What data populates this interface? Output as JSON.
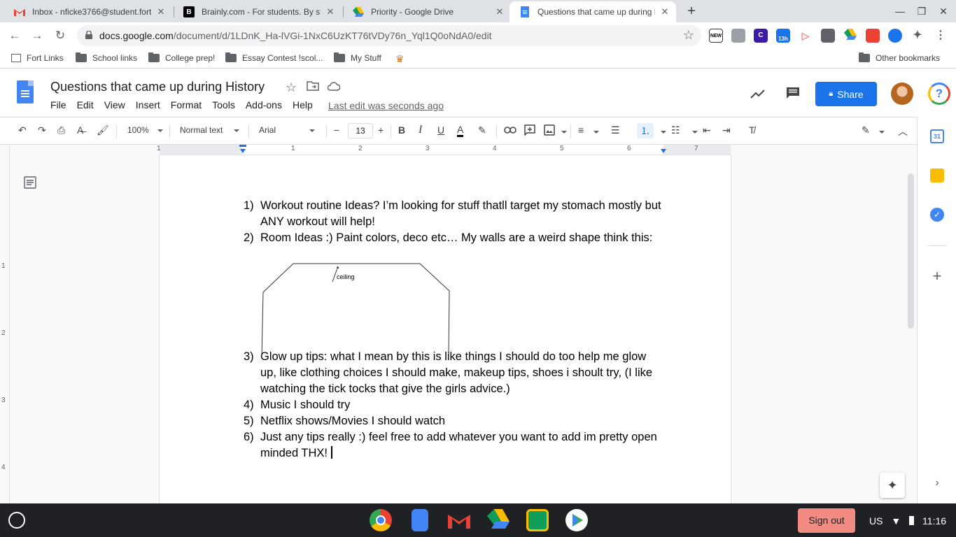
{
  "browser": {
    "tabs": [
      {
        "title": "Inbox - nficke3766@student.fort",
        "icon": "gmail-icon"
      },
      {
        "title": "Brainly.com - For students. By st",
        "icon": "brainly-icon"
      },
      {
        "title": "Priority - Google Drive",
        "icon": "drive-icon"
      },
      {
        "title": "Questions that came up during H",
        "icon": "docs-icon",
        "active": true
      }
    ],
    "url_host": "docs.google.com",
    "url_path": "/document/d/1LDnK_Ha-lVGi-1NxC6UzKT76tVDy76n_Yql1Q0oNdA0/edit",
    "extension_badges": [
      "NEW",
      "13h"
    ],
    "bookmarks": [
      "Fort Links",
      "School links",
      "College prep!",
      "Essay Contest !scol...",
      "My Stuff"
    ],
    "other_bookmarks": "Other bookmarks"
  },
  "doc": {
    "title": "Questions that came up during History",
    "menu": [
      "File",
      "Edit",
      "View",
      "Insert",
      "Format",
      "Tools",
      "Add-ons",
      "Help"
    ],
    "last_edit": "Last edit was seconds ago",
    "share_label": "Share",
    "toolbar": {
      "zoom": "100%",
      "style": "Normal text",
      "font": "Arial",
      "font_size": "13"
    },
    "ruler_numbers": [
      "1",
      "1",
      "2",
      "3",
      "4",
      "5",
      "6",
      "7"
    ],
    "vruler_numbers": [
      "1",
      "2",
      "3",
      "4"
    ],
    "items": [
      {
        "num": "1)",
        "text": "Workout routine Ideas? I’m looking for stuff thatll target my stomach mostly but ANY workout will help!"
      },
      {
        "num": "2)",
        "text": "Room Ideas :) Paint colors, deco etc… My walls are a weird shape think this:"
      },
      {
        "num": "3)",
        "text": "Glow up tips: what I mean by this is like things I should do too help me glow up, like clothing choices I should make, makeup tips, shoes i shoult try, (I like watching the tick tocks that give the girls advice.)"
      },
      {
        "num": "4)",
        "text": "Music I should try"
      },
      {
        "num": "5)",
        "text": "Netflix shows/Movies I should watch"
      },
      {
        "num": "6)",
        "text": "Just any tips really :) feel free to add whatever you want to add im pretty open minded THX! "
      }
    ],
    "drawing_label": "ceiling"
  },
  "shelf": {
    "sign_out": "Sign out",
    "locale": "US",
    "time": "11:16"
  },
  "colors": {
    "accent": "#1a73e8",
    "docs_blue": "#4285f4",
    "sign_out": "#f28b82"
  }
}
